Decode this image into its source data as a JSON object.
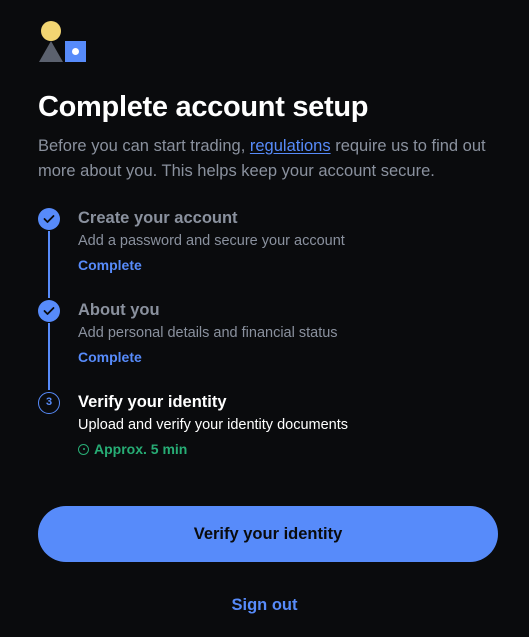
{
  "logo": {
    "icon": "account-setup-illustration-icon",
    "colors": {
      "circle": "#f2d572",
      "triangle": "#5b616e",
      "square": "#578bfa"
    }
  },
  "header": {
    "title": "Complete account setup"
  },
  "intro": {
    "before_link": "Before you can start trading, ",
    "link_text": "regulations",
    "after_link": " require us to find out more about you. This helps keep your account secure."
  },
  "steps": [
    {
      "marker": "check-icon",
      "title": "Create your account",
      "description": "Add a password and secure your account",
      "status": "Complete",
      "state": "complete"
    },
    {
      "marker": "check-icon",
      "title": "About you",
      "description": "Add personal details and financial status",
      "status": "Complete",
      "state": "complete"
    },
    {
      "marker": "3",
      "title": "Verify your identity",
      "description": "Upload and verify your identity documents",
      "status": "Approx. 5 min",
      "state": "current"
    }
  ],
  "actions": {
    "primary_label": "Verify your identity",
    "secondary_label": "Sign out"
  },
  "colors": {
    "background": "#0a0b0d",
    "accent": "#578bfa",
    "muted_text": "#8a919e",
    "success": "#27ad75"
  }
}
